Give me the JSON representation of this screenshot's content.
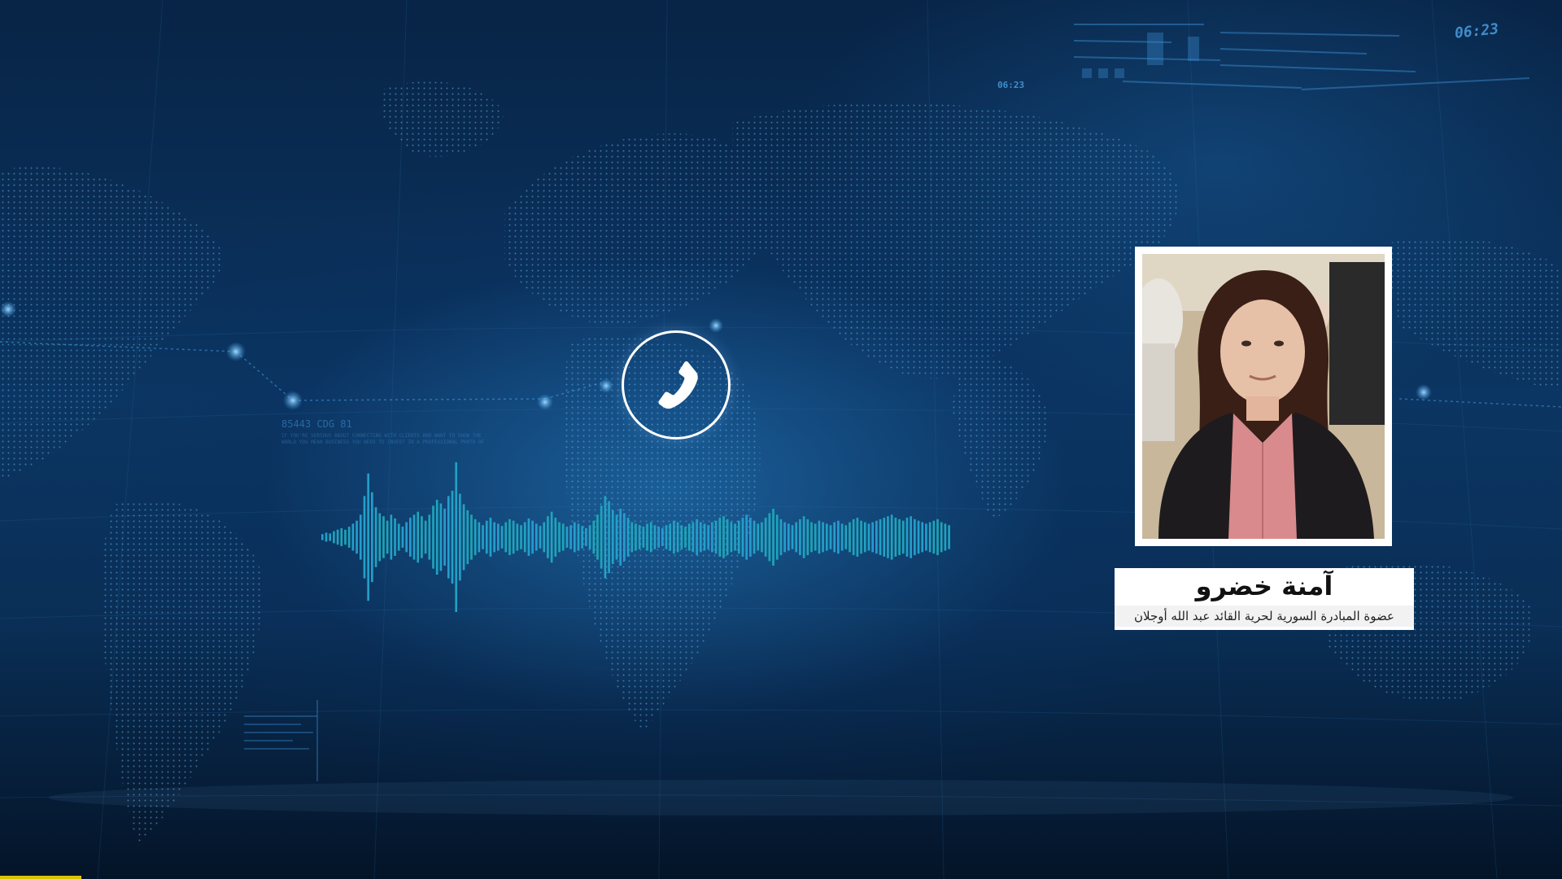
{
  "hud": {
    "time_top_right": "06:23",
    "time_small": "06:23",
    "code_label": "85443 CDG 81",
    "paragraph": "IF YOU'RE SERIOUS ABOUT CONNECTING WITH CLIENTS AND WANT TO SHOW THE WORLD YOU MEAN BUSINESS YOU NEED TO INVEST IN A PROFESSIONAL PHOTO OF"
  },
  "call": {
    "icon": "phone-icon"
  },
  "guest": {
    "name": "آمنة خضرو",
    "title": "عضوة المبادرة السورية لحرية القائد عبد الله أوجلان"
  },
  "colors": {
    "background": "#0b3562",
    "waveform_start": "#19b9a8",
    "waveform_end": "#2a8fe0",
    "caption_bg": "#ffffff"
  },
  "waveform": {
    "amplitudes": [
      0.04,
      0.06,
      0.05,
      0.08,
      0.1,
      0.12,
      0.1,
      0.14,
      0.18,
      0.22,
      0.3,
      0.55,
      0.85,
      0.6,
      0.4,
      0.32,
      0.28,
      0.22,
      0.3,
      0.25,
      0.18,
      0.14,
      0.2,
      0.26,
      0.3,
      0.34,
      0.28,
      0.22,
      0.3,
      0.42,
      0.5,
      0.45,
      0.38,
      0.55,
      0.62,
      1.0,
      0.58,
      0.44,
      0.36,
      0.3,
      0.24,
      0.2,
      0.16,
      0.22,
      0.26,
      0.2,
      0.18,
      0.15,
      0.2,
      0.24,
      0.22,
      0.18,
      0.16,
      0.2,
      0.25,
      0.22,
      0.18,
      0.15,
      0.2,
      0.28,
      0.34,
      0.26,
      0.2,
      0.18,
      0.14,
      0.16,
      0.2,
      0.18,
      0.15,
      0.12,
      0.16,
      0.22,
      0.3,
      0.42,
      0.55,
      0.48,
      0.36,
      0.3,
      0.38,
      0.32,
      0.26,
      0.2,
      0.18,
      0.16,
      0.14,
      0.18,
      0.2,
      0.16,
      0.14,
      0.12,
      0.16,
      0.18,
      0.22,
      0.2,
      0.16,
      0.14,
      0.18,
      0.2,
      0.24,
      0.2,
      0.18,
      0.16,
      0.2,
      0.22,
      0.26,
      0.28,
      0.24,
      0.2,
      0.18,
      0.22,
      0.26,
      0.3,
      0.26,
      0.22,
      0.18,
      0.2,
      0.26,
      0.32,
      0.38,
      0.3,
      0.24,
      0.2,
      0.18,
      0.16,
      0.2,
      0.24,
      0.28,
      0.24,
      0.2,
      0.18,
      0.22,
      0.2,
      0.18,
      0.16,
      0.2,
      0.22,
      0.18,
      0.16,
      0.2,
      0.24,
      0.26,
      0.22,
      0.2,
      0.18,
      0.2,
      0.22,
      0.24,
      0.26,
      0.28,
      0.3,
      0.26,
      0.24,
      0.22,
      0.26,
      0.28,
      0.24,
      0.22,
      0.2,
      0.18,
      0.2,
      0.22,
      0.24,
      0.2,
      0.18,
      0.16
    ]
  }
}
